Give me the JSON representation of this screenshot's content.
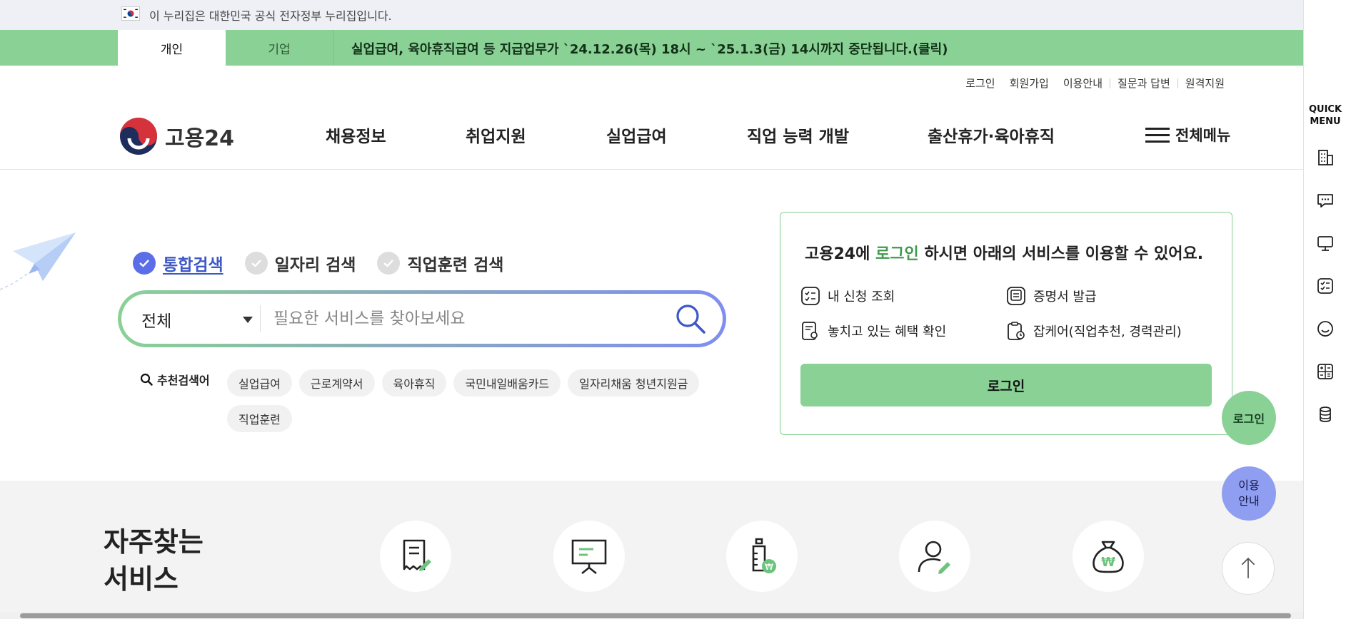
{
  "gov_banner": {
    "text": "이 누리집은 대한민국 공식 전자정부 누리집입니다."
  },
  "notice_bar": {
    "tabs": [
      "개인",
      "기업"
    ],
    "notice": "실업급여, 육아휴직급여 등 지급업무가 `24.12.26(목) 18시 ~ `25.1.3(금) 14시까지 중단됩니다.(클릭)"
  },
  "util_nav": [
    "로그인",
    "회원가입",
    "이용안내",
    "질문과 답변",
    "원격지원"
  ],
  "logo": {
    "text": "고용24"
  },
  "gnb": [
    "채용정보",
    "취업지원",
    "실업급여",
    "직업 능력 개발",
    "출산휴가·육아휴직"
  ],
  "all_menu": "전체메뉴",
  "search": {
    "tabs": [
      "통합검색",
      "일자리 검색",
      "직업훈련 검색"
    ],
    "scope": "전체",
    "placeholder": "필요한 서비스를 찾아보세요",
    "reco_label": "추천검색어",
    "keywords": [
      "실업급여",
      "근로계약서",
      "육아휴직",
      "국민내일배움카드",
      "일자리채움 청년지원금",
      "직업훈련"
    ]
  },
  "login_box": {
    "title_pre": "고용24에 ",
    "title_hl": "로그인",
    "title_post": " 하시면 아래의 서비스를 이용할 수 있어요.",
    "services": [
      "내 신청 조회",
      "증명서 발급",
      "놓치고 있는 혜택 확인",
      "잡케어(직업추천, 경력관리)"
    ],
    "button": "로그인"
  },
  "freq": {
    "title_line1": "자주찾는",
    "title_line2": "서비스"
  },
  "floating": {
    "login": "로그인",
    "guide_line1": "이용",
    "guide_line2": "안내"
  },
  "quick_menu": {
    "title_line1": "QUICK",
    "title_line2": "MENU"
  },
  "colors": {
    "green": "#8ad196",
    "blue": "#5b6ee8",
    "purple": "#8f9ef0"
  }
}
